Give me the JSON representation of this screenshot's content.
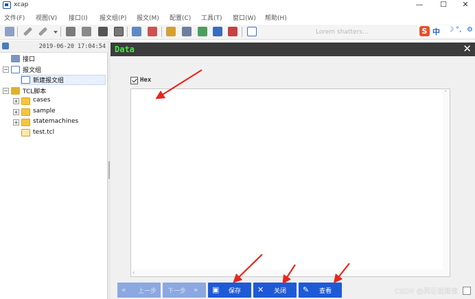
{
  "window": {
    "title": "xcap",
    "minimize": "—",
    "maximize": "☐",
    "close": "✕"
  },
  "menu": [
    "文件(F)",
    "视图(V)",
    "接口(I)",
    "报文组(P)",
    "报文(M)",
    "配置(C)",
    "工具(T)",
    "窗口(W)",
    "帮助(H)"
  ],
  "toolbar": {
    "icons": [
      "settings-icon",
      "pencil-icon",
      "pencil-dropdown-icon",
      "link-icon",
      "percent-icon",
      "book-icon",
      "open-book-icon",
      "list-add-icon",
      "list-remove-icon",
      "edit-icon",
      "align-icon",
      "export-icon",
      "chart-icon",
      "tag-icon",
      "chat-icon"
    ],
    "ime": {
      "s": "S",
      "zh": "中"
    },
    "faded_text": "Lorem shatters..."
  },
  "tree": {
    "timestamp": "2019-06-20 17:04:54",
    "nodes": [
      {
        "label": "接口"
      },
      {
        "label": "报文组"
      },
      {
        "label": "新建报文组"
      },
      {
        "label": "TCL脚本"
      },
      {
        "label": "cases"
      },
      {
        "label": "sample"
      },
      {
        "label": "statemachines"
      },
      {
        "label": "test.tcl"
      }
    ]
  },
  "dialog": {
    "title": "Data",
    "close": "✕",
    "hex_label": "Hex",
    "hex_checked": true,
    "buttons": {
      "prev": {
        "icon": "«",
        "label": "上一步",
        "enabled": false
      },
      "next": {
        "icon": "»",
        "label": "下一步",
        "enabled": false
      },
      "save": {
        "icon": "▣",
        "label": "保存",
        "enabled": true
      },
      "close": {
        "icon": "✕",
        "label": "关闭",
        "enabled": true
      },
      "view": {
        "icon": "✎",
        "label": "查看",
        "enabled": true
      }
    }
  },
  "watermark": "CSDN @风云说通信",
  "colors": {
    "accent": "#1f5ad6",
    "dialog_title": "#3cf03c",
    "arrow": "#e8261c"
  }
}
